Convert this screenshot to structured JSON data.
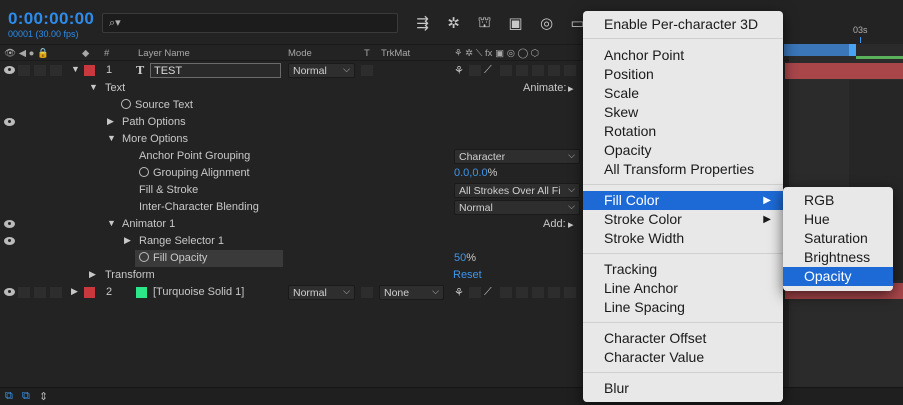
{
  "topbar": {
    "timecode": "0:00:00:00",
    "fps": "00001 (30.00 fps)",
    "search_placeholder": "",
    "search_icon": "search-icon"
  },
  "columns": {
    "layer_name": "Layer Name",
    "mode": "Mode",
    "t": "T",
    "trkmat": "TrkMat",
    "hash": "#"
  },
  "layers": {
    "l1_num": "1",
    "l1_name": "TEST",
    "l1_mode": "Normal",
    "text_group": "Text",
    "animate_label": "Animate:",
    "source_text": "Source Text",
    "path_options": "Path Options",
    "more_options": "More Options",
    "anchor_point_grouping": "Anchor Point Grouping",
    "anchor_point_grouping_val": "Character",
    "grouping_alignment": "Grouping Alignment",
    "grouping_alignment_val": "0.0,0.0",
    "grouping_alignment_unit": "%",
    "fill_stroke": "Fill & Stroke",
    "fill_stroke_val": "All Strokes Over All Fi",
    "inter_char_blending": "Inter-Character Blending",
    "inter_char_blending_val": "Normal",
    "animator": "Animator 1",
    "add_label": "Add:",
    "range_selector": "Range Selector 1",
    "fill_opacity": "Fill Opacity",
    "fill_opacity_val": "50",
    "fill_opacity_unit": "%",
    "transform": "Transform",
    "reset": "Reset",
    "l2_num": "2",
    "l2_name": "[Turquoise Solid 1]",
    "l2_mode": "Normal",
    "l2_trkmat": "None"
  },
  "colors": {
    "timecode": "#2d8ceb",
    "layer1_label": "#c8383c",
    "layer2_label": "#c8383c",
    "layer2_swatch": "#2ee68a",
    "menu_highlight": "#1d6ad6"
  },
  "timeline": {
    "ruler_3s": "03s"
  },
  "menu": {
    "items": [
      "Enable Per-character 3D",
      "Anchor Point",
      "Position",
      "Scale",
      "Skew",
      "Rotation",
      "Opacity",
      "All Transform Properties",
      "Fill Color",
      "Stroke Color",
      "Stroke Width",
      "Tracking",
      "Line Anchor",
      "Line Spacing",
      "Character Offset",
      "Character Value",
      "Blur"
    ],
    "active": "Fill Color"
  },
  "submenu": {
    "items": [
      "RGB",
      "Hue",
      "Saturation",
      "Brightness",
      "Opacity"
    ],
    "active": "Opacity"
  }
}
